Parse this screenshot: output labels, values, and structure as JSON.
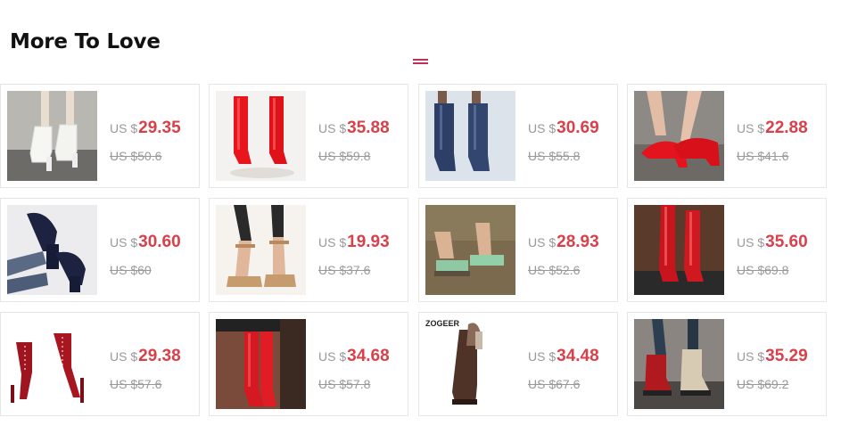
{
  "section": {
    "title": "More To Love"
  },
  "currency_label": "US $",
  "colors": {
    "price": "#d9404a",
    "accent": "#c0305a"
  },
  "products": [
    {
      "price": "29.35",
      "original": "US $50.6",
      "image": "white-ankle-boots",
      "brand": ""
    },
    {
      "price": "35.88",
      "original": "US $59.8",
      "image": "red-knee-boots",
      "brand": ""
    },
    {
      "price": "30.69",
      "original": "US $55.8",
      "image": "navy-mid-calf-boots",
      "brand": ""
    },
    {
      "price": "22.88",
      "original": "US $41.6",
      "image": "red-pumps",
      "brand": ""
    },
    {
      "price": "30.60",
      "original": "US $60",
      "image": "navy-platform-heels",
      "brand": ""
    },
    {
      "price": "19.93",
      "original": "US $37.6",
      "image": "tan-ankle-strap-sandals",
      "brand": ""
    },
    {
      "price": "28.93",
      "original": "US $52.6",
      "image": "green-slide-sandals",
      "brand": ""
    },
    {
      "price": "35.60",
      "original": "US $69.8",
      "image": "red-patent-tall-boots",
      "brand": ""
    },
    {
      "price": "29.38",
      "original": "US $57.6",
      "image": "red-lace-up-stiletto-boots",
      "brand": ""
    },
    {
      "price": "34.68",
      "original": "US $57.8",
      "image": "red-thigh-high-boots",
      "brand": ""
    },
    {
      "price": "34.48",
      "original": "US $67.6",
      "image": "brown-knee-high-boots",
      "brand": "ZOGEER"
    },
    {
      "price": "35.29",
      "original": "US $69.2",
      "image": "combat-boots",
      "brand": ""
    }
  ]
}
